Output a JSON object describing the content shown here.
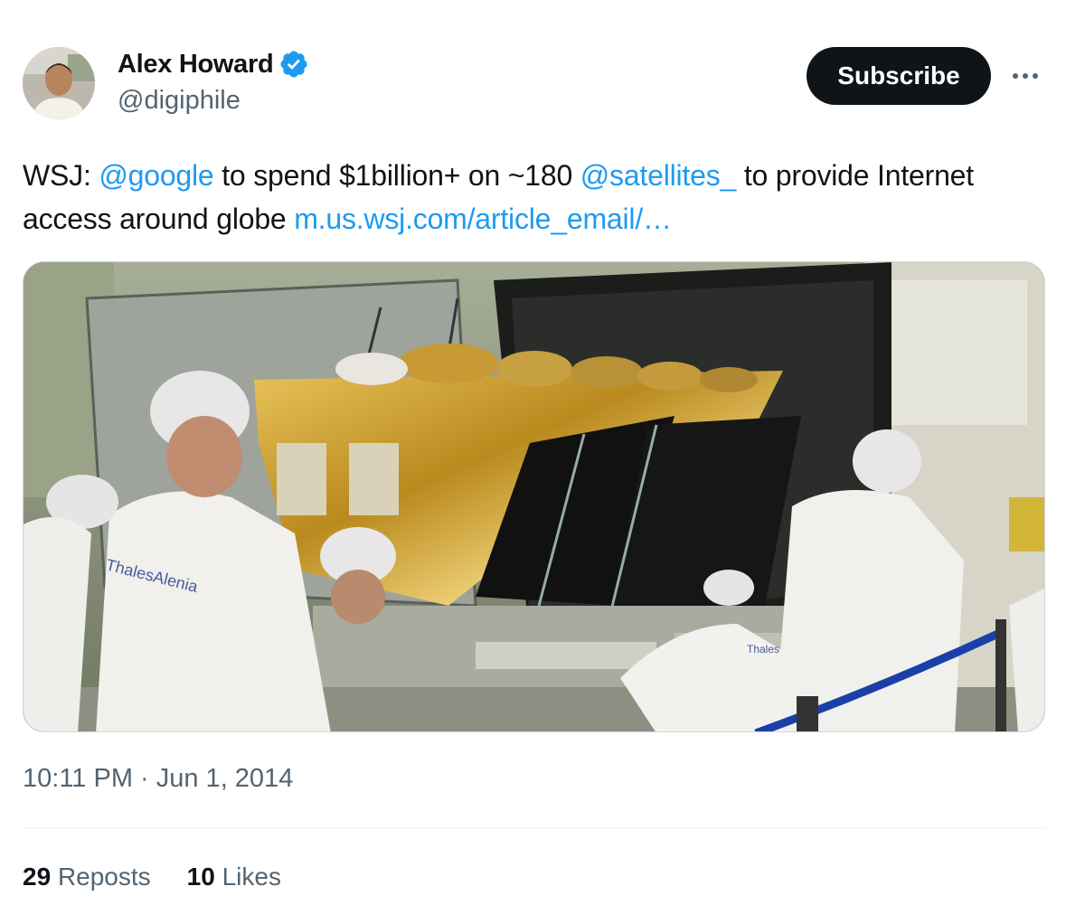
{
  "author": {
    "display_name": "Alex Howard",
    "handle": "@digiphile",
    "verified": true,
    "verified_icon": "verified-badge-icon"
  },
  "header": {
    "subscribe_label": "Subscribe",
    "more_icon": "more-horizontal-icon"
  },
  "tweet": {
    "prefix": "WSJ: ",
    "mention1": "@google",
    "middle": " to spend $1billion+ on ~180 ",
    "mention2": "@satellites_",
    "suffix": " to provide Internet access around globe ",
    "link": "m.us.wsj.com/article_email/…"
  },
  "media": {
    "logo_text_1": "ThalesAlenia",
    "logo_text_2": "Thales"
  },
  "meta": {
    "timestamp": "10:11 PM · Jun 1, 2014"
  },
  "stats": {
    "reposts_count": "29",
    "reposts_label": "Reposts",
    "likes_count": "10",
    "likes_label": "Likes"
  },
  "colors": {
    "link": "#1d9bf0",
    "text": "#0f1419",
    "secondary": "#536471",
    "button_bg": "#0f1419"
  }
}
